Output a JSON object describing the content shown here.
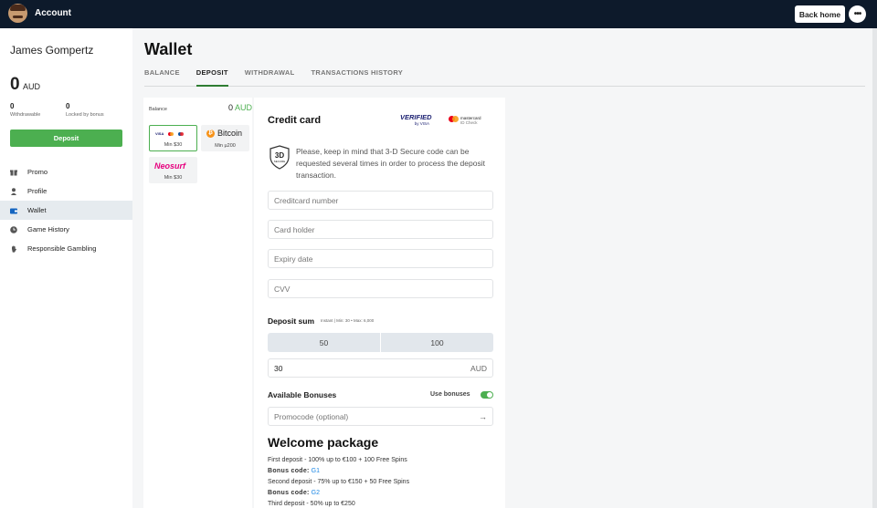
{
  "header": {
    "account_label": "Account",
    "back_home_label": "Back home",
    "more_label": "•••"
  },
  "user": {
    "name": "James Gompertz",
    "balance": "0",
    "currency": "AUD",
    "withdrawable_value": "0",
    "withdrawable_label": "Withdrawable",
    "locked_value": "0",
    "locked_label": "Locked by bonus",
    "deposit_button": "Deposit"
  },
  "nav": [
    {
      "label": "Promo",
      "icon": "gift-icon"
    },
    {
      "label": "Profile",
      "icon": "user-icon"
    },
    {
      "label": "Wallet",
      "icon": "wallet-icon",
      "active": true
    },
    {
      "label": "Game History",
      "icon": "clock-icon"
    },
    {
      "label": "Responsible Gambling",
      "icon": "hand-icon"
    }
  ],
  "page": {
    "title": "Wallet",
    "tabs": [
      "BALANCE",
      "DEPOSIT",
      "WITHDRAWAL",
      "TRANSACTIONS HISTORY"
    ],
    "active_tab": "DEPOSIT"
  },
  "methods": {
    "balance_label": "Balance",
    "balance_value": "0",
    "balance_currency": "AUD",
    "card_min": "Min $30",
    "card_logos": [
      "VISA"
    ],
    "bitcoin_label": "Bitcoin",
    "bitcoin_min": "Min µ200",
    "neosurf_label": "Neosurf",
    "neosurf_min": "Min $30"
  },
  "form": {
    "title": "Credit card",
    "verified_line1": "VERIFIED",
    "verified_line2": "by VISA",
    "mc_line1": "mastercard",
    "mc_line2": "ID Check",
    "secure_icon_text": "3D",
    "secure_icon_sub": "SECURE",
    "secure_note": "Please, keep in mind that 3-D Secure code can be requested several times in order to process the deposit transaction.",
    "placeholders": {
      "card_number": "Creditcard number",
      "card_holder": "Card holder",
      "expiry": "Expiry date",
      "cvv": "CVV"
    },
    "deposit_sum_label": "Deposit sum",
    "deposit_sum_info": "Instant | Min: 30 • Max: 6,000",
    "amount_options": [
      "50",
      "100"
    ],
    "amount_value": "30",
    "amount_currency": "AUD",
    "available_bonuses": "Available Bonuses",
    "use_bonuses": "Use bonuses",
    "use_bonuses_on": true,
    "promocode_placeholder": "Promocode (optional)",
    "welcome_title": "Welcome package",
    "package": {
      "line1": "First deposit - 100% up to €100 + 100 Free Spins",
      "code_label": "Bonus code:",
      "code1": "G1",
      "line2": "Second deposit - 75% up to €150 + 50 Free Spins",
      "code2": "G2",
      "line3": "Third deposit - 50% up to €250"
    }
  },
  "colors": {
    "topbar": "#0d1a2b",
    "accent_green": "#4caf50",
    "link_blue": "#1e88e5"
  }
}
